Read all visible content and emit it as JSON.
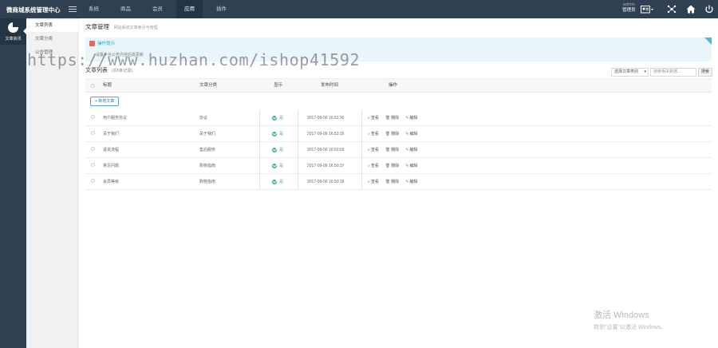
{
  "app": {
    "title": "微商城系统管理中心"
  },
  "topnav": {
    "items": [
      {
        "label": "系统"
      },
      {
        "label": "商品"
      },
      {
        "label": "会员"
      },
      {
        "label": "应用"
      },
      {
        "label": "插件"
      }
    ],
    "active": "应用"
  },
  "user": {
    "name": "admin",
    "role": "管理员"
  },
  "rail": {
    "label": "文章资讯"
  },
  "sidebar": {
    "items": [
      {
        "label": "文章列表"
      },
      {
        "label": "文章分类"
      },
      {
        "label": "公告管理"
      }
    ]
  },
  "page": {
    "title": "文章管理",
    "subtitle": "网站系统文章索引与管理"
  },
  "tips": {
    "title": "操作提示",
    "line": "设置平台公告内容后需更新"
  },
  "list": {
    "title": "文章列表",
    "count": "(共5条记录)",
    "filter": {
      "category_select": "选择文章类别",
      "search_placeholder": "搜索相关数据...",
      "search_button": "搜索"
    },
    "columns": {
      "title": "标题",
      "category": "文章分类",
      "show": "显示",
      "time": "发布时间",
      "ops": "操作"
    },
    "add_button": "+ 新增文章",
    "rows": [
      {
        "title": "用户服务协议",
        "category": "协议",
        "show": "是",
        "time": "2017-09-06 16:53:30"
      },
      {
        "title": "关于我们",
        "category": "关于我们",
        "show": "是",
        "time": "2017-09-06 16:53:15"
      },
      {
        "title": "退货流程",
        "category": "售后服务",
        "show": "是",
        "time": "2017-09-06 16:52:59"
      },
      {
        "title": "常见问题",
        "category": "购物指南",
        "show": "是",
        "time": "2017-09-06 16:50:37"
      },
      {
        "title": "会员等级",
        "category": "购物指南",
        "show": "是",
        "time": "2017-09-06 16:50:16"
      }
    ],
    "actions": {
      "view": "查看",
      "delete": "删除",
      "edit": "编辑"
    }
  },
  "watermark": {
    "text": "https://www.huzhan.com/ishop41592"
  },
  "windows_activation": {
    "line1": "激活 Windows",
    "line2": "转到\"设置\"以激活 Windows。"
  },
  "colors": {
    "topbar": "#2f4050",
    "accent_green": "#3fb27f",
    "tips_bg": "#e8f6fb",
    "link_blue": "#2ba3d8"
  }
}
